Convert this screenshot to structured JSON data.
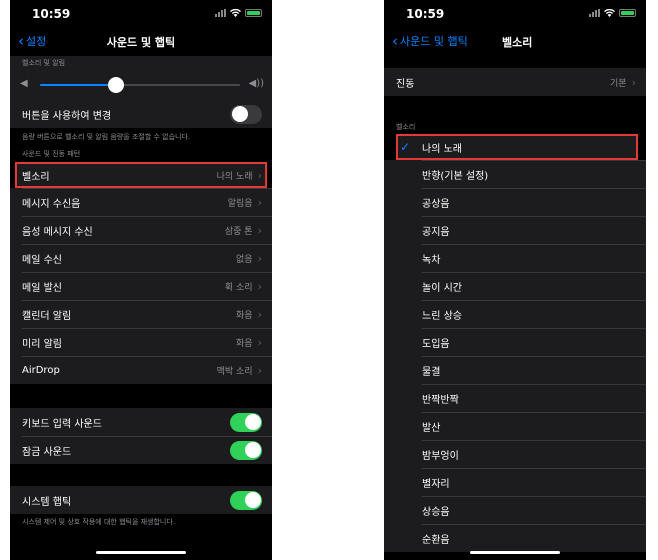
{
  "status_bar": {
    "time": "10:59"
  },
  "left": {
    "nav": {
      "back_label": "설정",
      "title": "사운드 및 햅틱"
    },
    "ringer_section_header": "벨소리 및 알림",
    "volume": {
      "level": 0.38
    },
    "change_with_buttons": {
      "label": "버튼을 사용하여 변경",
      "on": false
    },
    "change_with_buttons_footer": "음량 버튼으로 벨소리 및 알림 음량을 조절할 수 없습니다.",
    "patterns_section_header": "사운드 및 진동 패턴",
    "patterns": [
      {
        "label": "벨소리",
        "value": "나의 노래"
      },
      {
        "label": "메시지 수신음",
        "value": "알림음"
      },
      {
        "label": "음성 메시지 수신",
        "value": "삼중 톤"
      },
      {
        "label": "메일 수신",
        "value": "없음"
      },
      {
        "label": "메일 발신",
        "value": "휙 소리"
      },
      {
        "label": "캘린더 알림",
        "value": "화음"
      },
      {
        "label": "미리 알림",
        "value": "화음"
      },
      {
        "label": "AirDrop",
        "value": "맥박 소리"
      }
    ],
    "keyboard_clicks": {
      "label": "키보드 입력 사운드",
      "on": true
    },
    "lock_sound": {
      "label": "잠금 사운드",
      "on": true
    },
    "system_haptics": {
      "label": "시스템 햅틱",
      "on": true
    },
    "system_haptics_footer": "시스템 제어 및 상호 작용에 대한 햅틱을 재생합니다."
  },
  "right": {
    "nav": {
      "back_label": "사운드 및 햅틱",
      "title": "벨소리"
    },
    "vibration": {
      "label": "진동",
      "value": "기본"
    },
    "ringtones_section_header": "벨소리",
    "ringtones": [
      {
        "label": "나의 노래",
        "selected": true
      },
      {
        "label": "반향(기본 설정)",
        "selected": false
      },
      {
        "label": "공상음",
        "selected": false
      },
      {
        "label": "공지음",
        "selected": false
      },
      {
        "label": "녹차",
        "selected": false
      },
      {
        "label": "놀이 시간",
        "selected": false
      },
      {
        "label": "느린 상승",
        "selected": false
      },
      {
        "label": "도입음",
        "selected": false
      },
      {
        "label": "물결",
        "selected": false
      },
      {
        "label": "반짝반짝",
        "selected": false
      },
      {
        "label": "발산",
        "selected": false
      },
      {
        "label": "밤부엉이",
        "selected": false
      },
      {
        "label": "별자리",
        "selected": false
      },
      {
        "label": "상승음",
        "selected": false
      },
      {
        "label": "순환음",
        "selected": false
      }
    ]
  },
  "colors": {
    "accent": "#0a84ff",
    "toggle_on": "#30d158",
    "highlight": "#e53935",
    "cell_bg": "#1c1c1e"
  }
}
